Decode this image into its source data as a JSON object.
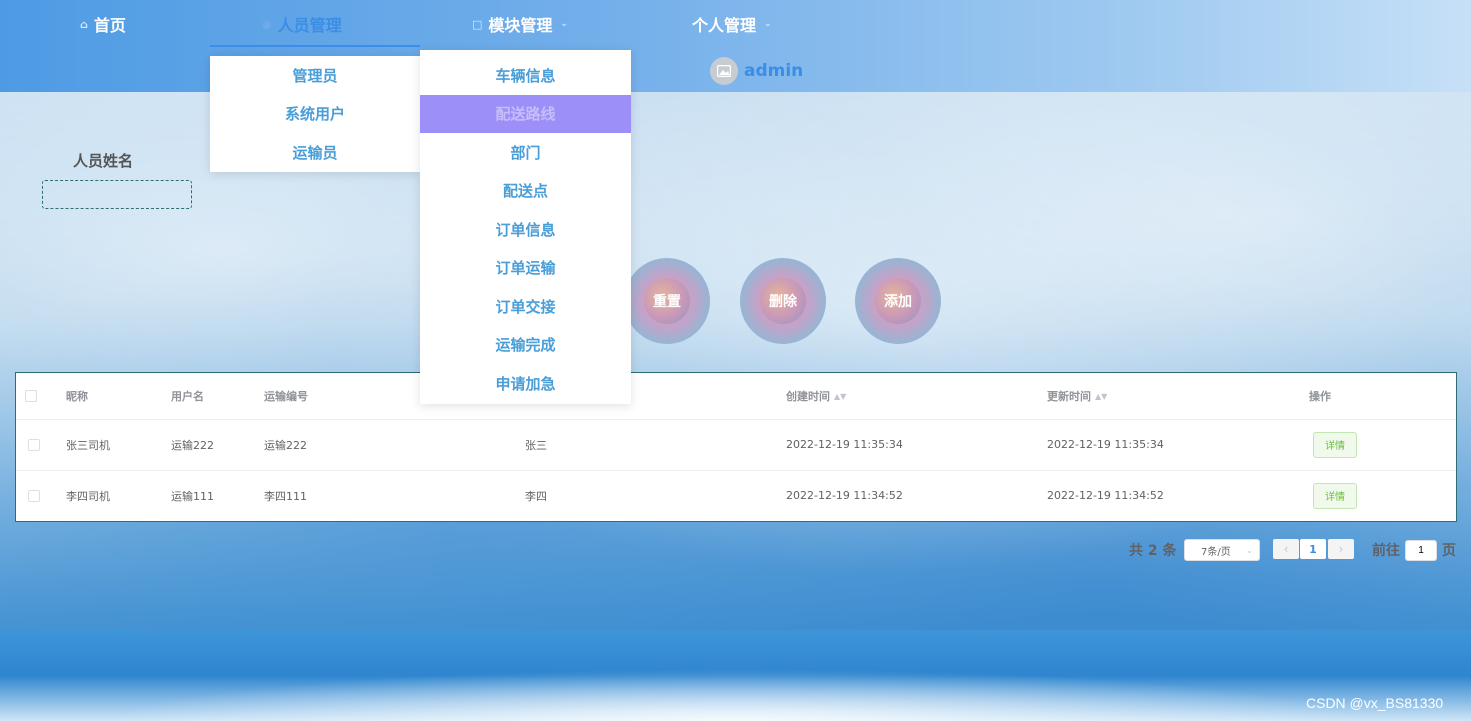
{
  "nav": {
    "home": "首页",
    "personnel": "人员管理",
    "modules": "模块管理",
    "personal": "个人管理"
  },
  "user": {
    "name": "admin"
  },
  "personnel_menu": [
    "管理员",
    "系统用户",
    "运输员"
  ],
  "module_menu": [
    "车辆信息",
    "配送路线",
    "部门",
    "配送点",
    "订单信息",
    "订单运输",
    "订单交接",
    "运输完成",
    "申请加急"
  ],
  "search": {
    "label": "人员姓名",
    "value": ""
  },
  "buttons": {
    "reset": "重置",
    "delete": "删除",
    "add": "添加"
  },
  "table": {
    "headers": {
      "nickname": "昵称",
      "username": "用户名",
      "transport_no": "运输编号",
      "created": "创建时间",
      "updated": "更新时间",
      "action": "操作"
    },
    "rows": [
      {
        "nickname": "张三司机",
        "username": "运输222",
        "transport_no": "运输222",
        "name": "张三",
        "created": "2022-12-19 11:35:34",
        "updated": "2022-12-19 11:35:34",
        "action": "详情"
      },
      {
        "nickname": "李四司机",
        "username": "运输111",
        "transport_no": "李四111",
        "name": "李四",
        "created": "2022-12-19 11:34:52",
        "updated": "2022-12-19 11:34:52",
        "action": "详情"
      }
    ]
  },
  "pagination": {
    "total": "共 2 条",
    "page_size": "7条/页",
    "current": "1",
    "goto_label": "前往",
    "goto_value": "1",
    "page_suffix": "页"
  },
  "watermark": "CSDN @vx_BS81330",
  "colors": {
    "accent": "#3a8ee6",
    "menu_hover": "#9c8ff7",
    "success": "#67c23a"
  }
}
